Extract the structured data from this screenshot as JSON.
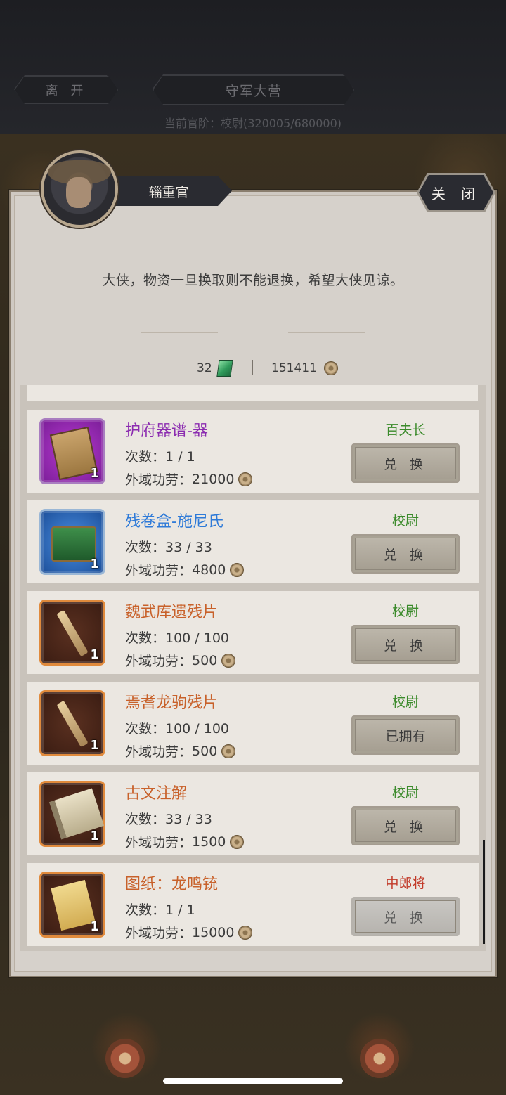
{
  "topbar": {
    "leave_label": "离 开",
    "camp_title": "守军大营",
    "rank_line": "当前官阶：校尉(320005/680000)"
  },
  "dialog": {
    "npc_title": "辎重官",
    "close_label": "关 闭",
    "message": "大侠，物资一旦换取则不能退换，希望大侠见谅。",
    "currency_jade": "32",
    "currency_coin": "151411"
  },
  "items": [
    {
      "name": "护府器谱-器",
      "quality": "purple",
      "count": "1",
      "times": "次数：1 / 1",
      "cost_label": "外域功劳：",
      "cost": "21000",
      "requirement": "百夫长",
      "requirement_color": "green",
      "action": "兑 换",
      "icon": "manual-book-icon"
    },
    {
      "name": "残卷盒-施尼氏",
      "quality": "blue",
      "count": "1",
      "times": "次数：33 / 33",
      "cost_label": "外域功劳：",
      "cost": "4800",
      "requirement": "校尉",
      "requirement_color": "green",
      "action": "兑 换",
      "icon": "chest-icon"
    },
    {
      "name": "魏武库遗残片",
      "quality": "orange",
      "count": "1",
      "times": "次数：100 / 100",
      "cost_label": "外域功劳：",
      "cost": "500",
      "requirement": "校尉",
      "requirement_color": "green",
      "action": "兑 换",
      "icon": "scroll-fragment-icon"
    },
    {
      "name": "焉耆龙驹残片",
      "quality": "orange",
      "count": "1",
      "times": "次数：100 / 100",
      "cost_label": "外域功劳：",
      "cost": "500",
      "requirement": "校尉",
      "requirement_color": "green",
      "action": "已拥有",
      "icon": "scroll-fragment-icon"
    },
    {
      "name": "古文注解",
      "quality": "orange",
      "count": "1",
      "times": "次数：33 / 33",
      "cost_label": "外域功劳：",
      "cost": "1500",
      "requirement": "校尉",
      "requirement_color": "green",
      "action": "兑 换",
      "icon": "ancient-scroll-icon"
    },
    {
      "name": "图纸：龙鸣铳",
      "quality": "orange",
      "count": "1",
      "times": "次数：1 / 1",
      "cost_label": "外域功劳：",
      "cost": "15000",
      "requirement": "中郎将",
      "requirement_color": "red",
      "action": "兑 换",
      "icon": "blueprint-icon"
    }
  ],
  "colors": {
    "purple_name": "#8b2bb0",
    "blue_name": "#2e7ad8",
    "orange_name": "#c8612a",
    "requirement_green": "#3a8a2a",
    "requirement_red": "#c23a28"
  }
}
